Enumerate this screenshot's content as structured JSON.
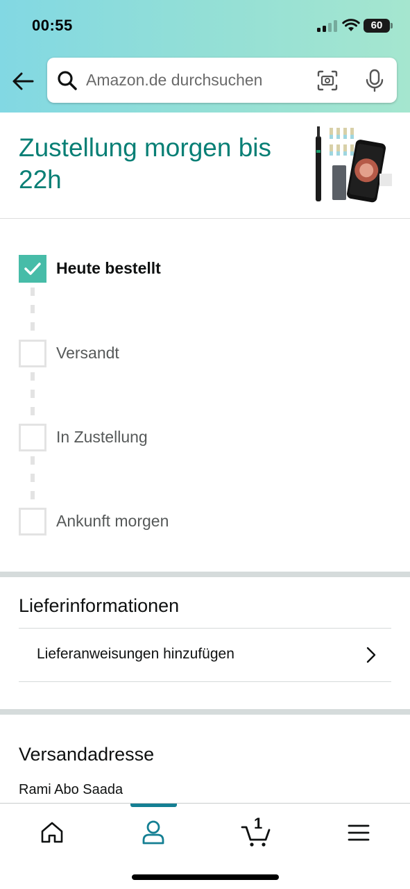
{
  "status_bar": {
    "time": "00:55",
    "battery": "60"
  },
  "search": {
    "placeholder": "Amazon.de durchsuchen"
  },
  "delivery": {
    "title": "Zustellung morgen bis 22h",
    "product_image_icon": "ear-camera-product-image"
  },
  "tracker": {
    "steps": [
      {
        "label": "Heute bestellt",
        "done": true
      },
      {
        "label": "Versandt",
        "done": false
      },
      {
        "label": "In Zustellung",
        "done": false
      },
      {
        "label": "Ankunft morgen",
        "done": false
      }
    ]
  },
  "delivery_info": {
    "title": "Lieferinformationen",
    "add_instructions": "Lieferanweisungen hinzufügen"
  },
  "shipping_address": {
    "title": "Versandadresse",
    "name": "Rami Abo Saada"
  },
  "bottom_nav": {
    "items": [
      "home-icon",
      "account-icon",
      "cart-icon",
      "menu-icon"
    ],
    "active": "account-icon",
    "cart_count": "1"
  },
  "colors": {
    "accent_teal": "#087f75",
    "check_green": "#47bca8",
    "nav_active": "#147f93"
  }
}
